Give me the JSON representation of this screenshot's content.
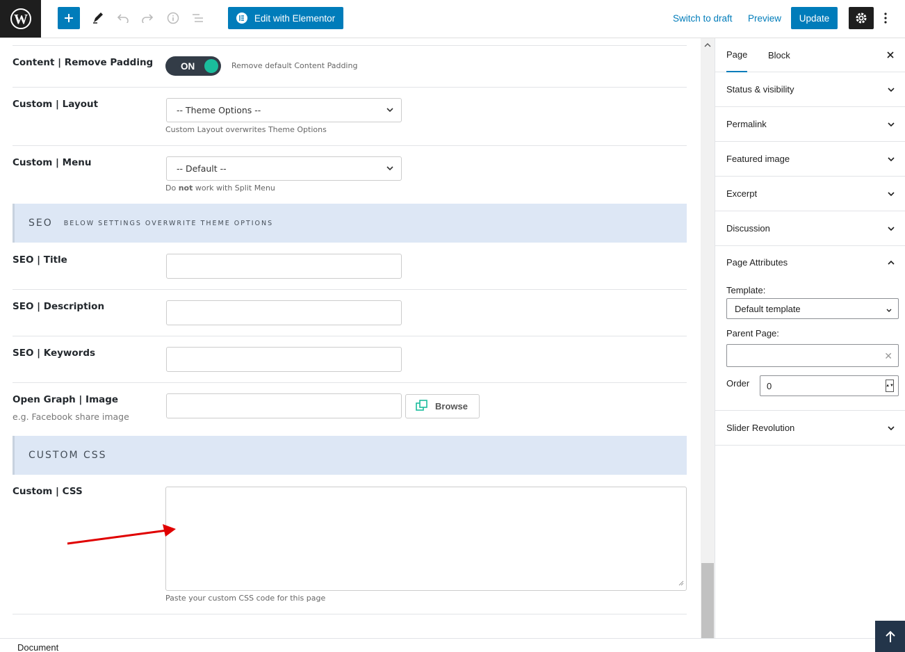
{
  "toolbar": {
    "elementor_label": "Edit with Elementor",
    "switch_draft_label": "Switch to draft",
    "preview_label": "Preview",
    "update_label": "Update"
  },
  "fields": {
    "remove_padding": {
      "label": "Content | Remove Padding",
      "toggle": "ON",
      "hint": "Remove default Content Padding"
    },
    "layout": {
      "label": "Custom | Layout",
      "value": "-- Theme Options --",
      "hint": "Custom Layout overwrites Theme Options"
    },
    "menu": {
      "label": "Custom | Menu",
      "value": "-- Default --",
      "hint_pre": "Do ",
      "hint_bold": "not",
      "hint_post": " work with Split Menu"
    },
    "seo_section": {
      "title": "SEO",
      "subtitle": "BELOW SETTINGS OVERWRITE THEME OPTIONS"
    },
    "seo_title": {
      "label": "SEO | Title"
    },
    "seo_description": {
      "label": "SEO | Description"
    },
    "seo_keywords": {
      "label": "SEO | Keywords"
    },
    "og_image": {
      "label": "Open Graph | Image",
      "sub": "e.g. Facebook share image",
      "browse": "Browse"
    },
    "css_section": {
      "title": "CUSTOM CSS"
    },
    "custom_css": {
      "label": "Custom | CSS",
      "hint": "Paste your custom CSS code for this page"
    }
  },
  "sidebar": {
    "tabs": [
      "Page",
      "Block"
    ],
    "panels": [
      "Status & visibility",
      "Permalink",
      "Featured image",
      "Excerpt",
      "Discussion"
    ],
    "attributes": {
      "title": "Page Attributes",
      "template_label": "Template:",
      "template_value": "Default template",
      "parent_label": "Parent Page:",
      "order_label": "Order",
      "order_value": "0"
    },
    "slider": "Slider Revolution"
  },
  "footer": {
    "document": "Document"
  },
  "colors": {
    "accent": "#007cba",
    "toggle_on": "#1abc9c",
    "section_bg": "#dde7f5",
    "annotation_arrow": "#e00000"
  }
}
